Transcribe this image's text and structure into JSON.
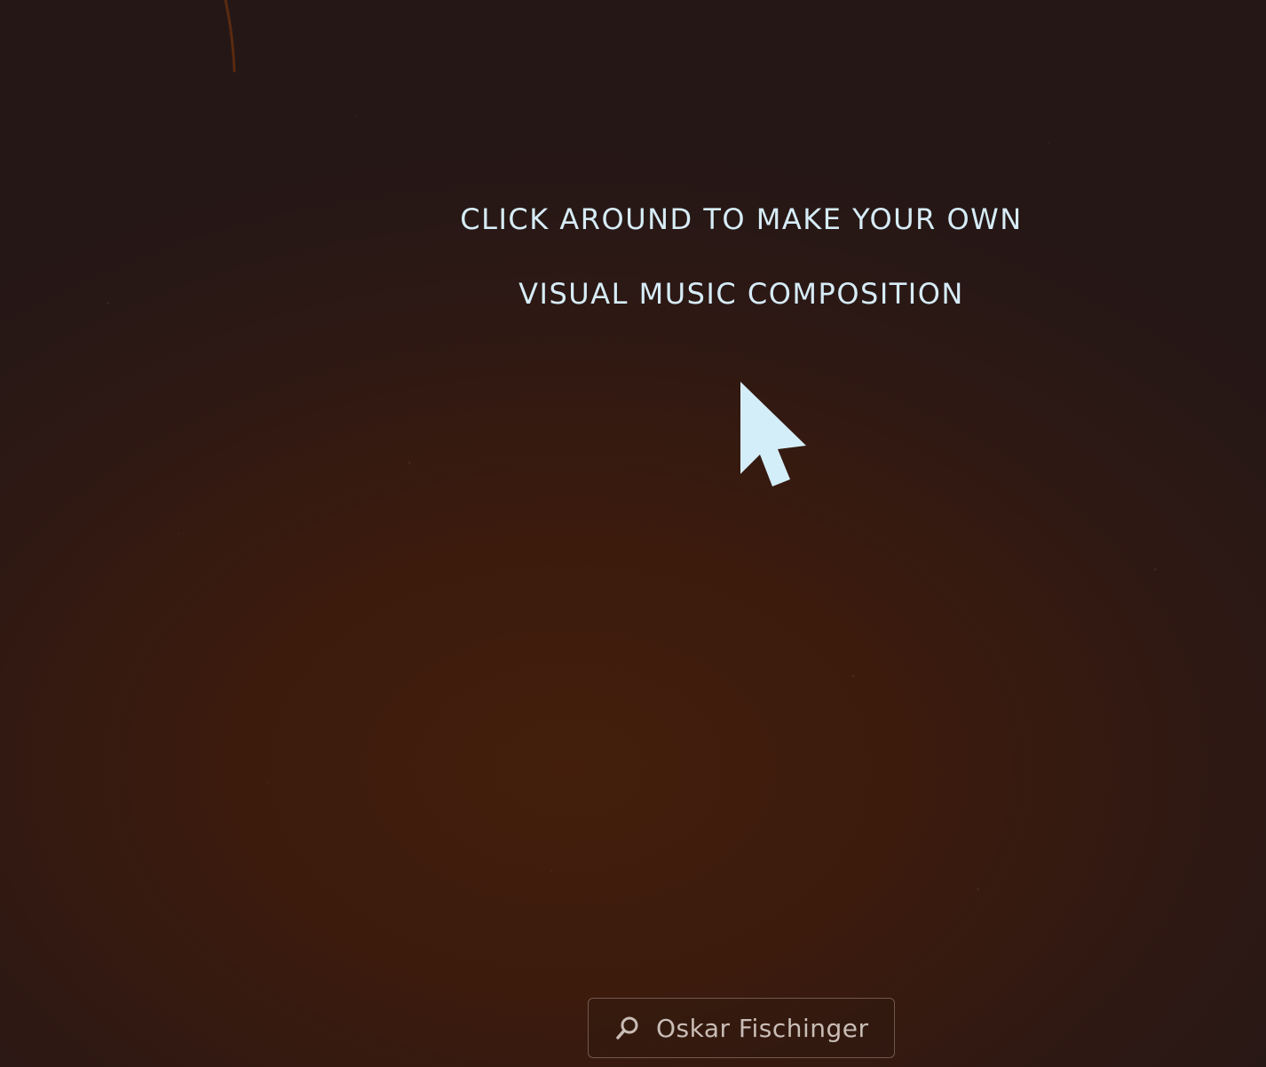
{
  "instructions": {
    "line1": "CLICK AROUND TO MAKE YOUR OWN",
    "line2": "VISUAL MUSIC COMPOSITION"
  },
  "search": {
    "icon": "search-icon",
    "label": "Oskar Fischinger"
  },
  "colors": {
    "background_dark": "#2a1816",
    "background_warm": "#431e0c",
    "text_accent": "#d6ecf7",
    "cursor_fill": "#d4eef9"
  }
}
